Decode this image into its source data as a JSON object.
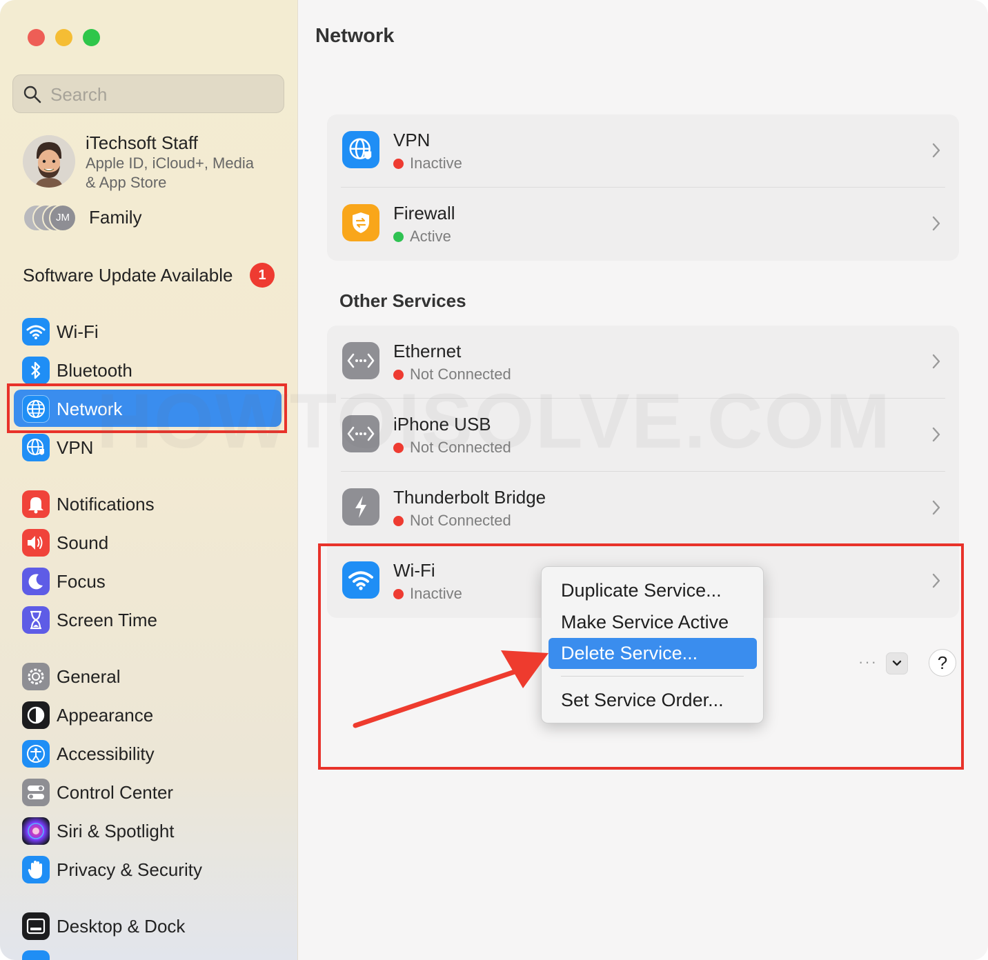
{
  "sidebar": {
    "search_placeholder": "Search",
    "account": {
      "name": "iTechsoft Staff",
      "sub1": "Apple ID, iCloud+, Media",
      "sub2": "& App Store"
    },
    "family": {
      "label": "Family",
      "initials": "JM"
    },
    "update": {
      "label": "Software Update Available",
      "badge": "1"
    },
    "items": [
      {
        "label": "Wi-Fi",
        "icon": "wifi-icon",
        "color": "#1f8ef5"
      },
      {
        "label": "Bluetooth",
        "icon": "bluetooth-icon",
        "color": "#1f8ef5"
      },
      {
        "label": "Network",
        "icon": "globe-icon",
        "color": "#1f8ef5",
        "selected": true
      },
      {
        "label": "VPN",
        "icon": "vpn-globe-icon",
        "color": "#1f8ef5"
      },
      {
        "label": "Notifications",
        "icon": "bell-icon",
        "color": "#f0433a"
      },
      {
        "label": "Sound",
        "icon": "speaker-icon",
        "color": "#f0433a"
      },
      {
        "label": "Focus",
        "icon": "moon-icon",
        "color": "#5e5ce6"
      },
      {
        "label": "Screen Time",
        "icon": "hourglass-icon",
        "color": "#5e5ce6"
      },
      {
        "label": "General",
        "icon": "gear-icon",
        "color": "#8e8e93"
      },
      {
        "label": "Appearance",
        "icon": "appearance-icon",
        "color": "#1c1c1e"
      },
      {
        "label": "Accessibility",
        "icon": "accessibility-icon",
        "color": "#1f8ef5"
      },
      {
        "label": "Control Center",
        "icon": "toggles-icon",
        "color": "#8e8e93"
      },
      {
        "label": "Siri & Spotlight",
        "icon": "siri-icon",
        "color": "#3b2b6b"
      },
      {
        "label": "Privacy & Security",
        "icon": "hand-icon",
        "color": "#1f8ef5"
      },
      {
        "label": "Desktop & Dock",
        "icon": "dock-icon",
        "color": "#1c1c1e"
      }
    ]
  },
  "main": {
    "title": "Network",
    "top_services": [
      {
        "name": "VPN",
        "status": "Inactive",
        "status_color": "#ee3b31",
        "icon": "vpn-globe-icon"
      },
      {
        "name": "Firewall",
        "status": "Active",
        "status_color": "#2fc252",
        "icon": "firewall-shield-icon"
      }
    ],
    "section_title": "Other Services",
    "other_services": [
      {
        "name": "Ethernet",
        "status": "Not Connected",
        "status_color": "#ee3b31",
        "icon": "ethernet-icon"
      },
      {
        "name": "iPhone USB",
        "status": "Not Connected",
        "status_color": "#ee3b31",
        "icon": "ethernet-icon"
      },
      {
        "name": "Thunderbolt Bridge",
        "status": "Not Connected",
        "status_color": "#ee3b31",
        "icon": "thunderbolt-icon"
      },
      {
        "name": "Wi-Fi",
        "status": "Inactive",
        "status_color": "#ee3b31",
        "icon": "wifi-icon"
      }
    ],
    "context_menu": [
      "Duplicate Service...",
      "Make Service Active",
      "Delete Service...",
      "Set Service Order..."
    ],
    "highlighted_menu_item": "Delete Service...",
    "footer": {
      "ellipsis": "···",
      "help": "?"
    }
  },
  "watermark": "HOWTOISOLVE.COM",
  "colors": {
    "accent": "#3a8dee",
    "annotation_red": "#e8322a"
  }
}
